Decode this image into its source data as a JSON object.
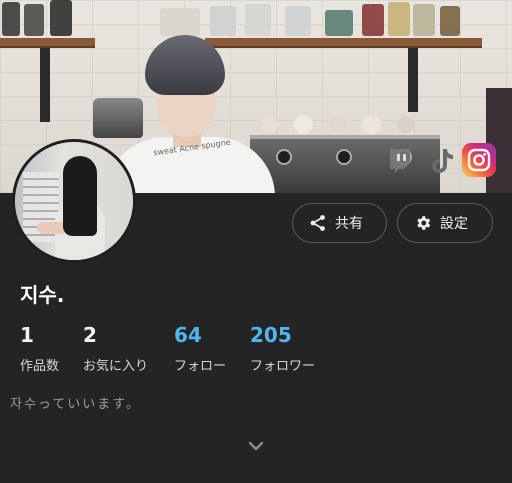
{
  "banner": {
    "collar_text": "sweat Acne spugne",
    "social_icons": [
      "twitch-icon",
      "tiktok-icon",
      "instagram-icon"
    ]
  },
  "profile": {
    "name": "지수.",
    "bio": "자수っていいます。"
  },
  "buttons": {
    "share_label": "共有",
    "settings_label": "設定"
  },
  "stats": [
    {
      "value": "1",
      "label": "作品数"
    },
    {
      "value": "2",
      "label": "お気に入り"
    },
    {
      "value": "64",
      "label": "フォロー"
    },
    {
      "value": "205",
      "label": "フォロワー"
    }
  ],
  "colors": {
    "background": "#242424",
    "accent": "#4fb7f0"
  }
}
